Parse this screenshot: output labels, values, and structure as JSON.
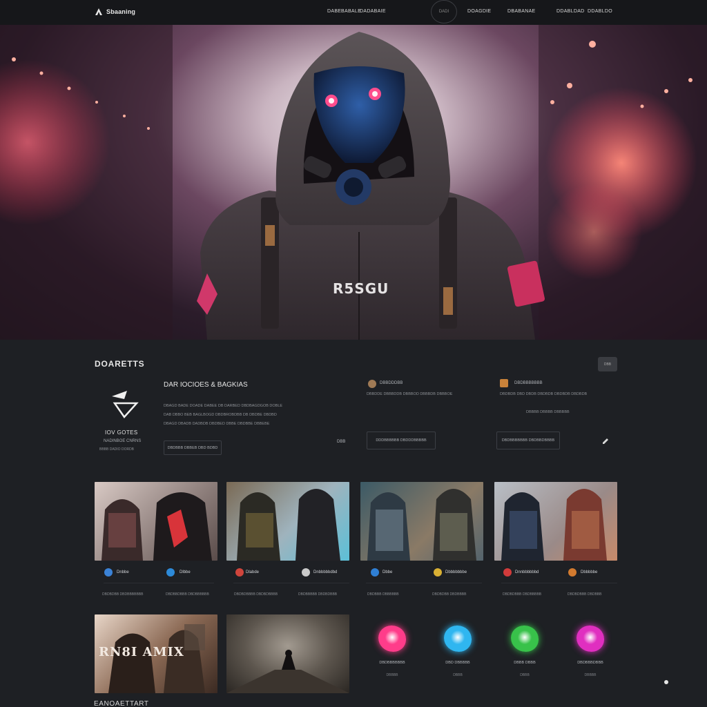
{
  "header": {
    "logo_text": "Sbaaning",
    "nav": [
      "DABE",
      "BABALE",
      "DADABAIE"
    ],
    "circle_label": "DADI",
    "nav_right": [
      "DOAGDIE",
      "DBABANAE",
      "DDABLDAD",
      "DDABLDO"
    ]
  },
  "hero": {
    "chest_text": "R5SGU"
  },
  "section": {
    "title": "DOARETTS",
    "button_label": "DBB"
  },
  "feature": {
    "name": "IOV GOTES",
    "sub": "NADINBOE CNRNS",
    "sub2": "BBBB DADIO DORDB"
  },
  "card_main": {
    "title": "DAR IOCIOES & BAGKIAS",
    "lines": [
      "DBAGD BADE DOADE DABEE DB DARBED DBDBAGDGOB DOBLE",
      "DAB DBBO BEB BAGLBOGD DBDBROBDBB DB DBDBE DBDBD",
      "DBAGD DBADB DADBDB DBDBED DBBE DBDBBE DBBEBE"
    ],
    "button_label": "DBDBBB DBBEB DBD BDBD",
    "side_label": "DBB"
  },
  "card_two": {
    "label": "DBBDDDBB",
    "lines": [
      "DBBDDE DBBBDDB DBBBOD DBBBDB DBBBOE"
    ],
    "button_label": "DDDBBBBBB DBDDDBBBBB"
  },
  "card_three": {
    "label": "DBDBBBBBBB",
    "lines": [
      "DBDBDB DBD DBDB DBDBDB DBDBDB DBDBDB",
      "DBBBB DBBBB DBBBBB"
    ],
    "button_label": "DBDBBBBBBB DBDBBDBBBB"
  },
  "products": [
    {
      "name": "Dnbbe",
      "meta": "DBDBDBB DBDBBBBBBB",
      "color": "#3b82d6"
    },
    {
      "name": "Dlbbe",
      "meta": "DBDBBDBBB DBDBBBBBB",
      "color": "#2d8ad8"
    },
    {
      "name": "Dlabde",
      "meta": "DBDBDBBBB DBDBDBBBB",
      "color": "#d0453c"
    },
    {
      "name": "Dnbbbbbdbd",
      "meta": "DBDBBBBB DBDBDBBB",
      "color": "#c9c9c9"
    },
    {
      "name": "Dbbe",
      "meta": "DBDBBB DBBBBBB",
      "color": "#2f7fd4"
    },
    {
      "name": "Dbbbbbbbe",
      "meta": "DBDBDBB DBDBBBB",
      "color": "#d9b034"
    },
    {
      "name": "Dnnbbbbbbd",
      "meta": "DBDBDBBB DBDBBBBB",
      "color": "#d13b3b"
    },
    {
      "name": "Dbbbbbe",
      "meta": "DBDBDBBB DBDBBB",
      "color": "#d27a2f"
    }
  ],
  "banner_text": "RN8I AMIX",
  "blobs": [
    {
      "label": "DBDBBBBBBB",
      "sub": "DBBBB",
      "color": "#ff3c8a"
    },
    {
      "label": "DBD DBBBBB",
      "sub": "DBBB",
      "color": "#2fb6f0"
    },
    {
      "label": "DBBB DBBB",
      "sub": "DBBB",
      "color": "#38c24a"
    },
    {
      "label": "DBDBBBDBBB",
      "sub": "DBBBB",
      "color": "#e02fc0"
    }
  ],
  "footer": {
    "title": "EANOAETTART"
  }
}
